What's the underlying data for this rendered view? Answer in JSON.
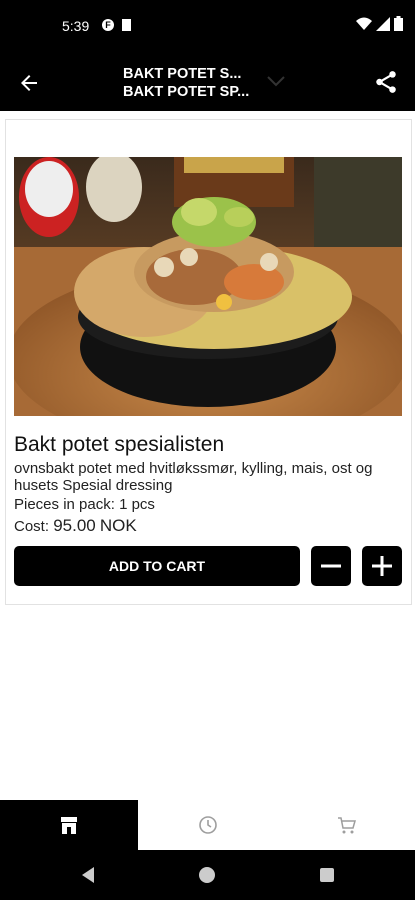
{
  "status_bar": {
    "time": "5:39"
  },
  "app_bar": {
    "title_line1": "BAKT POTET S...",
    "title_line2": "BAKT POTET SP..."
  },
  "product": {
    "title": "Bakt potet spesialisten",
    "description": "ovnsbakt potet med hvitløkssmør, kylling, mais, ost og husets Spesial dressing",
    "pieces_label": "Pieces in pack:",
    "pieces_value": "1 pcs",
    "cost_label": "Cost:",
    "cost_value": "95.00",
    "currency": "NOK",
    "image_icon": "baked-potato-photo"
  },
  "actions": {
    "add_to_cart": "ADD TO CART"
  },
  "tabs": [
    {
      "icon": "store-icon",
      "active": true
    },
    {
      "icon": "clock-icon",
      "active": false
    },
    {
      "icon": "cart-icon",
      "active": false
    }
  ],
  "colors": {
    "bar": "#000000",
    "accent": "#000000",
    "inactive_icon": "#9e9e9e"
  }
}
